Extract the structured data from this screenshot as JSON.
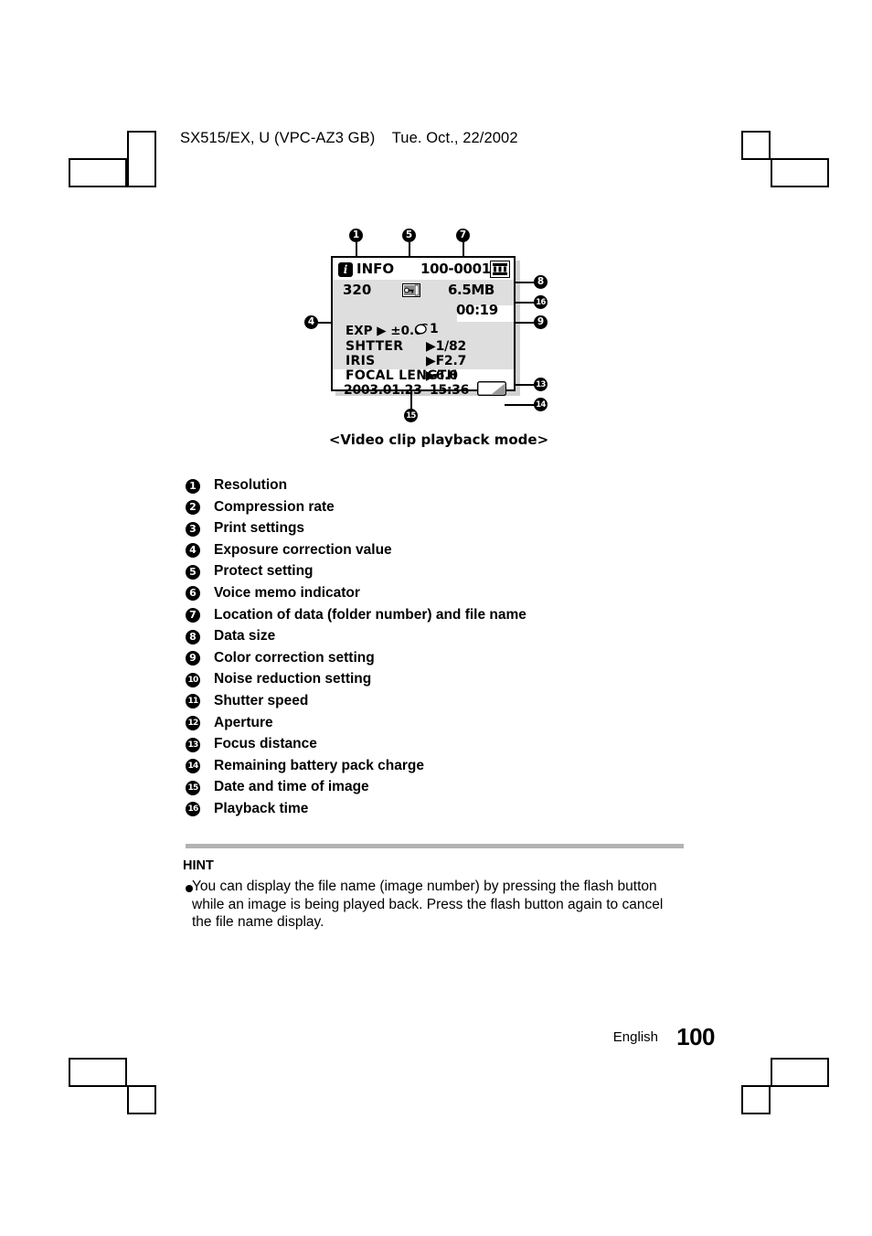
{
  "header": {
    "text": "SX515/EX, U (VPC-AZ3 GB)    Tue. Oct., 22/2002"
  },
  "figure": {
    "caption": "<Video clip playback mode>",
    "lcd": {
      "info_icon": "info-icon",
      "info_label": "INFO",
      "file_location": "100-0001",
      "film_icon": "film-strip-icon",
      "resolution": "320",
      "protect_icon": "protect-key-icon",
      "data_size": "6.5MB",
      "playback_time": "00:19",
      "exposure": "EXP ▶ ±0.0",
      "color_correction_icon": "color-correction-icon",
      "color_correction_value": "1",
      "shutter_label": "SHTTER",
      "shutter_value": "▶1/82",
      "iris_label": "IRIS",
      "iris_value": "▶F2.7",
      "focal_label": "FOCAL LENGTH",
      "focal_value": "▶6.0",
      "date": "2003.01.23",
      "time": "15:36",
      "battery_icon": "battery-icon"
    },
    "callouts": [
      {
        "n": "1"
      },
      {
        "n": "5"
      },
      {
        "n": "7"
      },
      {
        "n": "8"
      },
      {
        "n": "16"
      },
      {
        "n": "9"
      },
      {
        "n": "4"
      },
      {
        "n": "13"
      },
      {
        "n": "14"
      },
      {
        "n": "15"
      }
    ]
  },
  "legend": {
    "items": [
      {
        "num": "1",
        "label": "Resolution"
      },
      {
        "num": "2",
        "label": "Compression rate"
      },
      {
        "num": "3",
        "label": "Print settings"
      },
      {
        "num": "4",
        "label": "Exposure correction value"
      },
      {
        "num": "5",
        "label": "Protect setting"
      },
      {
        "num": "6",
        "label": "Voice memo indicator"
      },
      {
        "num": "7",
        "label": "Location of data (folder number) and file name"
      },
      {
        "num": "8",
        "label": "Data size"
      },
      {
        "num": "9",
        "label": "Color correction setting"
      },
      {
        "num": "10",
        "label": "Noise reduction setting"
      },
      {
        "num": "11",
        "label": "Shutter speed"
      },
      {
        "num": "12",
        "label": "Aperture"
      },
      {
        "num": "13",
        "label": "Focus distance"
      },
      {
        "num": "14",
        "label": "Remaining battery pack charge"
      },
      {
        "num": "15",
        "label": "Date and time of image"
      },
      {
        "num": "16",
        "label": "Playback time"
      }
    ]
  },
  "hint": {
    "title": "HINT",
    "body": "You can display the file name (image number) by pressing the flash button while an image is being played back. Press the flash button again to cancel the file name display."
  },
  "footer": {
    "language": "English",
    "page": "100"
  }
}
